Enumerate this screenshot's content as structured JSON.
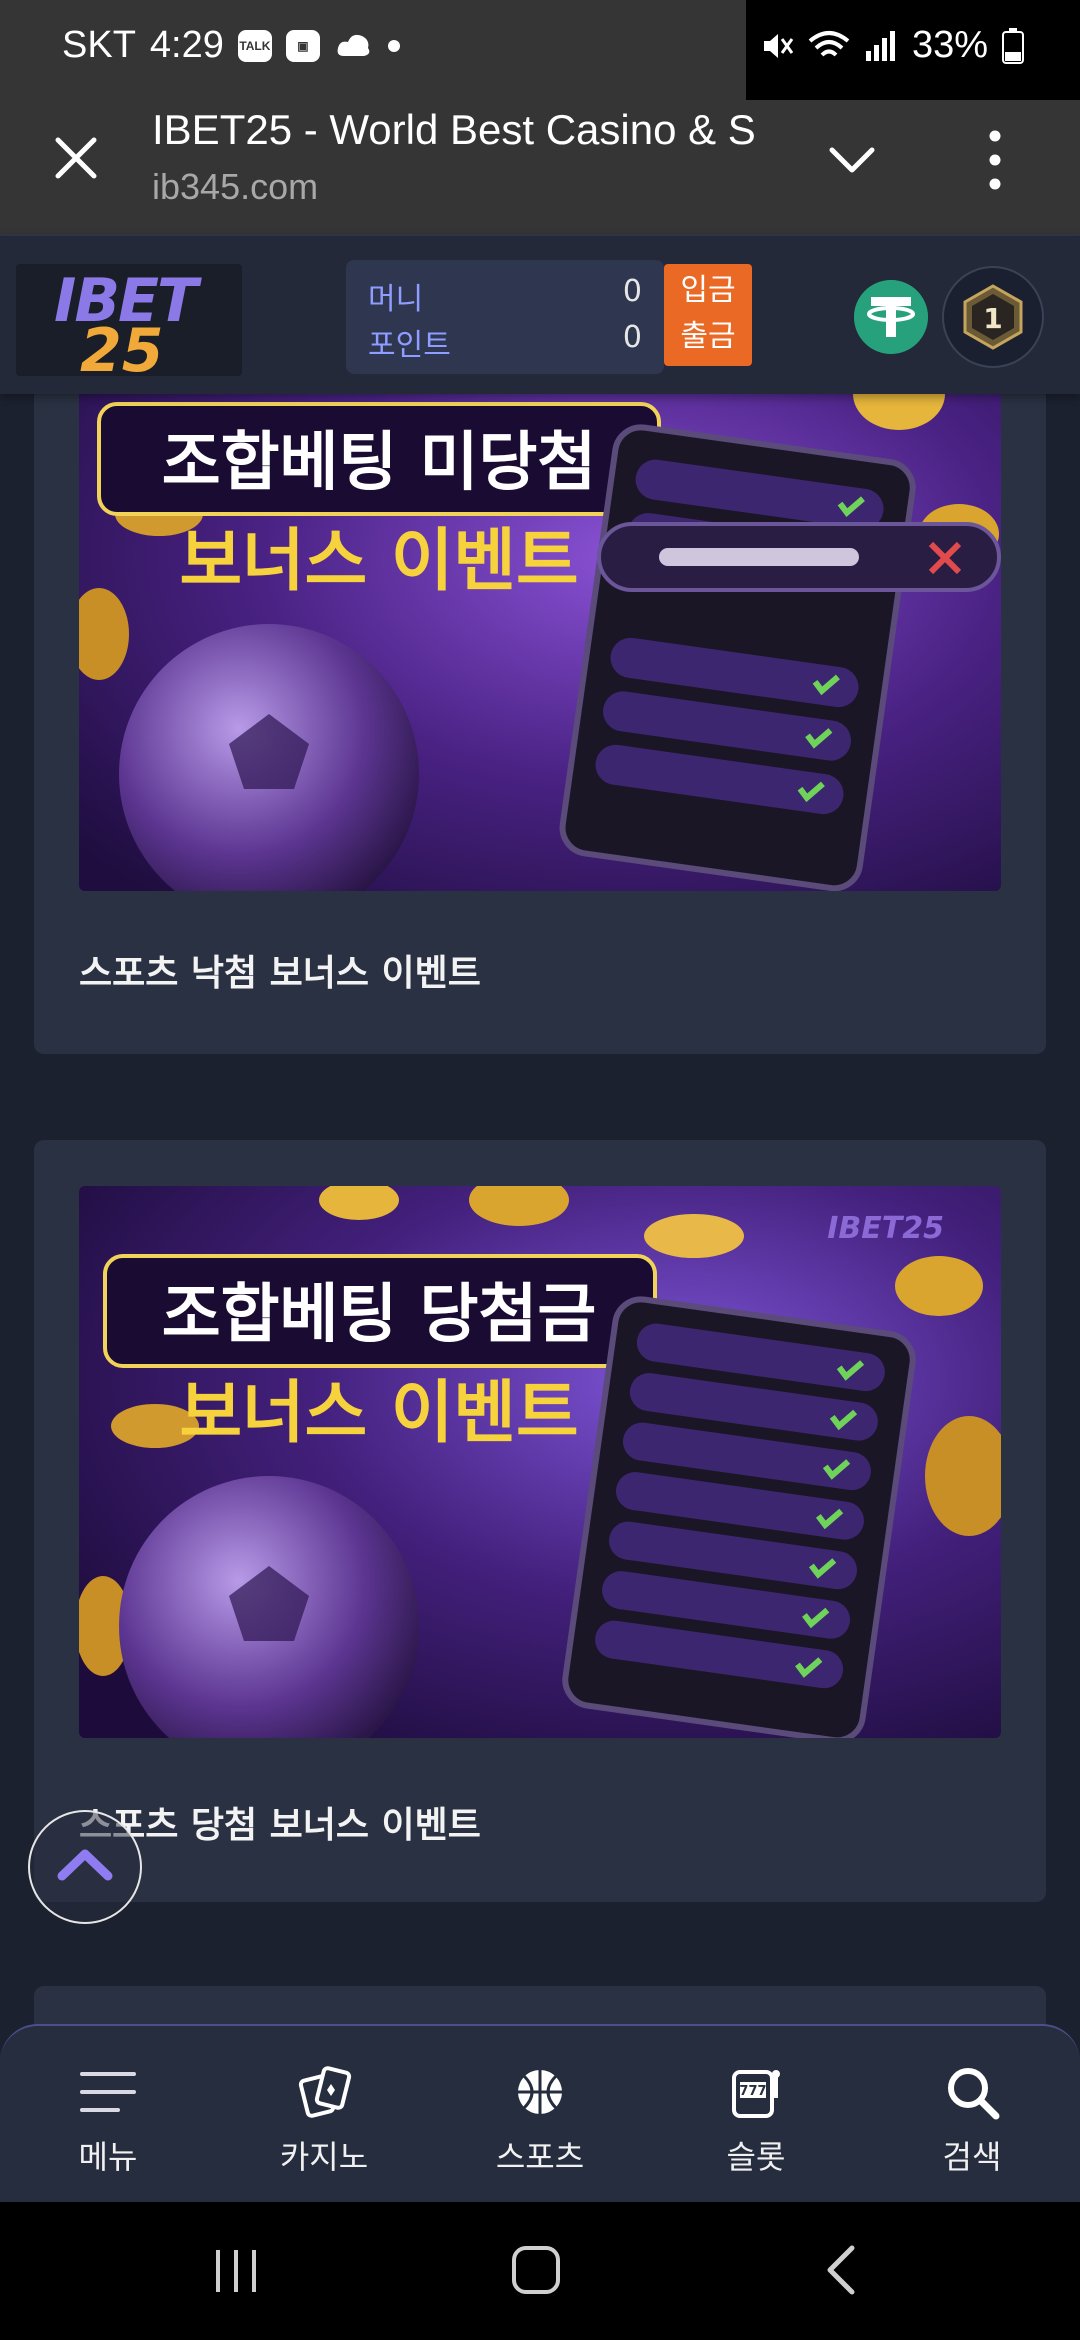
{
  "status_bar": {
    "carrier": "SKT",
    "time": "4:29",
    "battery": "33%",
    "icons": [
      "talk-icon",
      "gallery-icon",
      "weather-icon",
      "mute-icon",
      "wifi-icon",
      "signal-icon",
      "battery-icon"
    ]
  },
  "browser": {
    "title": "IBET25 - World Best Casino & S",
    "url": "ib345.com"
  },
  "site": {
    "logo_line1": "IBET",
    "logo_line2": "25",
    "wallet": {
      "money_label": "머니",
      "money_value": "0",
      "point_label": "포인트",
      "point_value": "0"
    },
    "deposit_label": "입금",
    "withdraw_label": "출금",
    "level": "1"
  },
  "events": [
    {
      "banner_title": "조합베팅 미당첨",
      "banner_subtitle": "보너스 이벤트",
      "title": "스포츠 낙첨 보너스 이벤트"
    },
    {
      "banner_title": "조합베팅 당첨금",
      "banner_subtitle": "보너스 이벤트",
      "banner_logo": "IBET25",
      "title": "스포츠 당첨 보너스 이벤트"
    }
  ],
  "bottom_nav": [
    {
      "label": "메뉴",
      "icon": "menu-icon"
    },
    {
      "label": "카지노",
      "icon": "cards-icon"
    },
    {
      "label": "스포츠",
      "icon": "basketball-icon"
    },
    {
      "label": "슬롯",
      "icon": "slot-icon"
    },
    {
      "label": "검색",
      "icon": "search-icon"
    }
  ],
  "colors": {
    "page_bg": "#1c2130",
    "card_bg": "#2a3142",
    "header_bg": "#232938",
    "accent_orange": "#ea6a25",
    "accent_purple": "#8b79e8",
    "tether_green": "#26a17b"
  }
}
